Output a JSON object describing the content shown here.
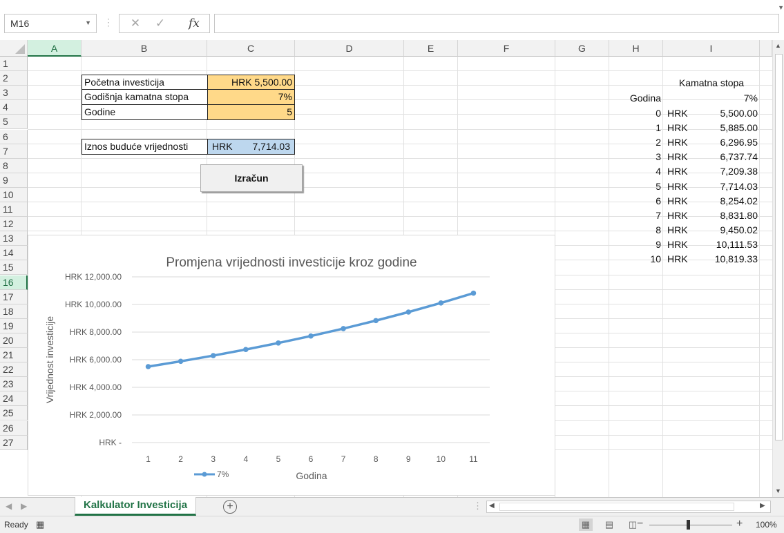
{
  "formula_bar": {
    "name_box": "M16",
    "cancel_icon": "✕",
    "enter_icon": "✓",
    "fx": "fx",
    "formula": ""
  },
  "columns": [
    "A",
    "B",
    "C",
    "D",
    "E",
    "F",
    "G",
    "H",
    "I"
  ],
  "active_column": "A",
  "rows": [
    "1",
    "2",
    "3",
    "4",
    "5",
    "6",
    "7",
    "8",
    "9",
    "10",
    "11",
    "12",
    "13",
    "14",
    "15",
    "16",
    "17",
    "18",
    "19",
    "20",
    "21",
    "22",
    "23",
    "24",
    "25",
    "26",
    "27"
  ],
  "active_row": "16",
  "inputs": {
    "initial_label": "Početna investicija",
    "initial_value": "HRK 5,500.00",
    "rate_label": "Godišnja kamatna stopa",
    "rate_value": "7%",
    "years_label": "Godine",
    "years_value": "5",
    "future_label": "Iznos buduće vrijednosti",
    "future_currency": "HRK",
    "future_value": "7,714.03"
  },
  "calculate_button": "Izračun",
  "table": {
    "rate_header": "Kamatna stopa",
    "year_header": "Godina",
    "rate_value": "7%",
    "rows": [
      {
        "year": "0",
        "cur": "HRK",
        "val": "5,500.00"
      },
      {
        "year": "1",
        "cur": "HRK",
        "val": "5,885.00"
      },
      {
        "year": "2",
        "cur": "HRK",
        "val": "6,296.95"
      },
      {
        "year": "3",
        "cur": "HRK",
        "val": "6,737.74"
      },
      {
        "year": "4",
        "cur": "HRK",
        "val": "7,209.38"
      },
      {
        "year": "5",
        "cur": "HRK",
        "val": "7,714.03"
      },
      {
        "year": "6",
        "cur": "HRK",
        "val": "8,254.02"
      },
      {
        "year": "7",
        "cur": "HRK",
        "val": "8,831.80"
      },
      {
        "year": "8",
        "cur": "HRK",
        "val": "9,450.02"
      },
      {
        "year": "9",
        "cur": "HRK",
        "val": "10,111.53"
      },
      {
        "year": "10",
        "cur": "HRK",
        "val": "10,819.33"
      }
    ]
  },
  "chart_data": {
    "type": "line",
    "title": "Promjena vrijednosti investicije kroz godine",
    "xlabel": "Godina",
    "ylabel": "Vrijednost investicije",
    "categories": [
      "1",
      "2",
      "3",
      "4",
      "5",
      "6",
      "7",
      "8",
      "9",
      "10",
      "11"
    ],
    "ylim": [
      0,
      12000
    ],
    "y_ticks": [
      0,
      2000,
      4000,
      6000,
      8000,
      10000,
      12000
    ],
    "y_tick_labels": [
      "HRK -",
      "HRK 2,000.00",
      "HRK 4,000.00",
      "HRK 6,000.00",
      "HRK 8,000.00",
      "HRK 10,000.00",
      "HRK 12,000.00"
    ],
    "grid": true,
    "legend": "bottom",
    "series": [
      {
        "name": "7%",
        "color": "#5b9bd5",
        "values": [
          5500.0,
          5885.0,
          6296.95,
          6737.74,
          7209.38,
          7714.03,
          8254.02,
          8831.8,
          9450.02,
          10111.53,
          10819.33
        ]
      }
    ]
  },
  "sheet_tab": "Kalkulator Investicija",
  "add_sheet": "+",
  "status": {
    "text": "Ready",
    "zoom": "100%",
    "minus": "−",
    "plus": "+"
  }
}
